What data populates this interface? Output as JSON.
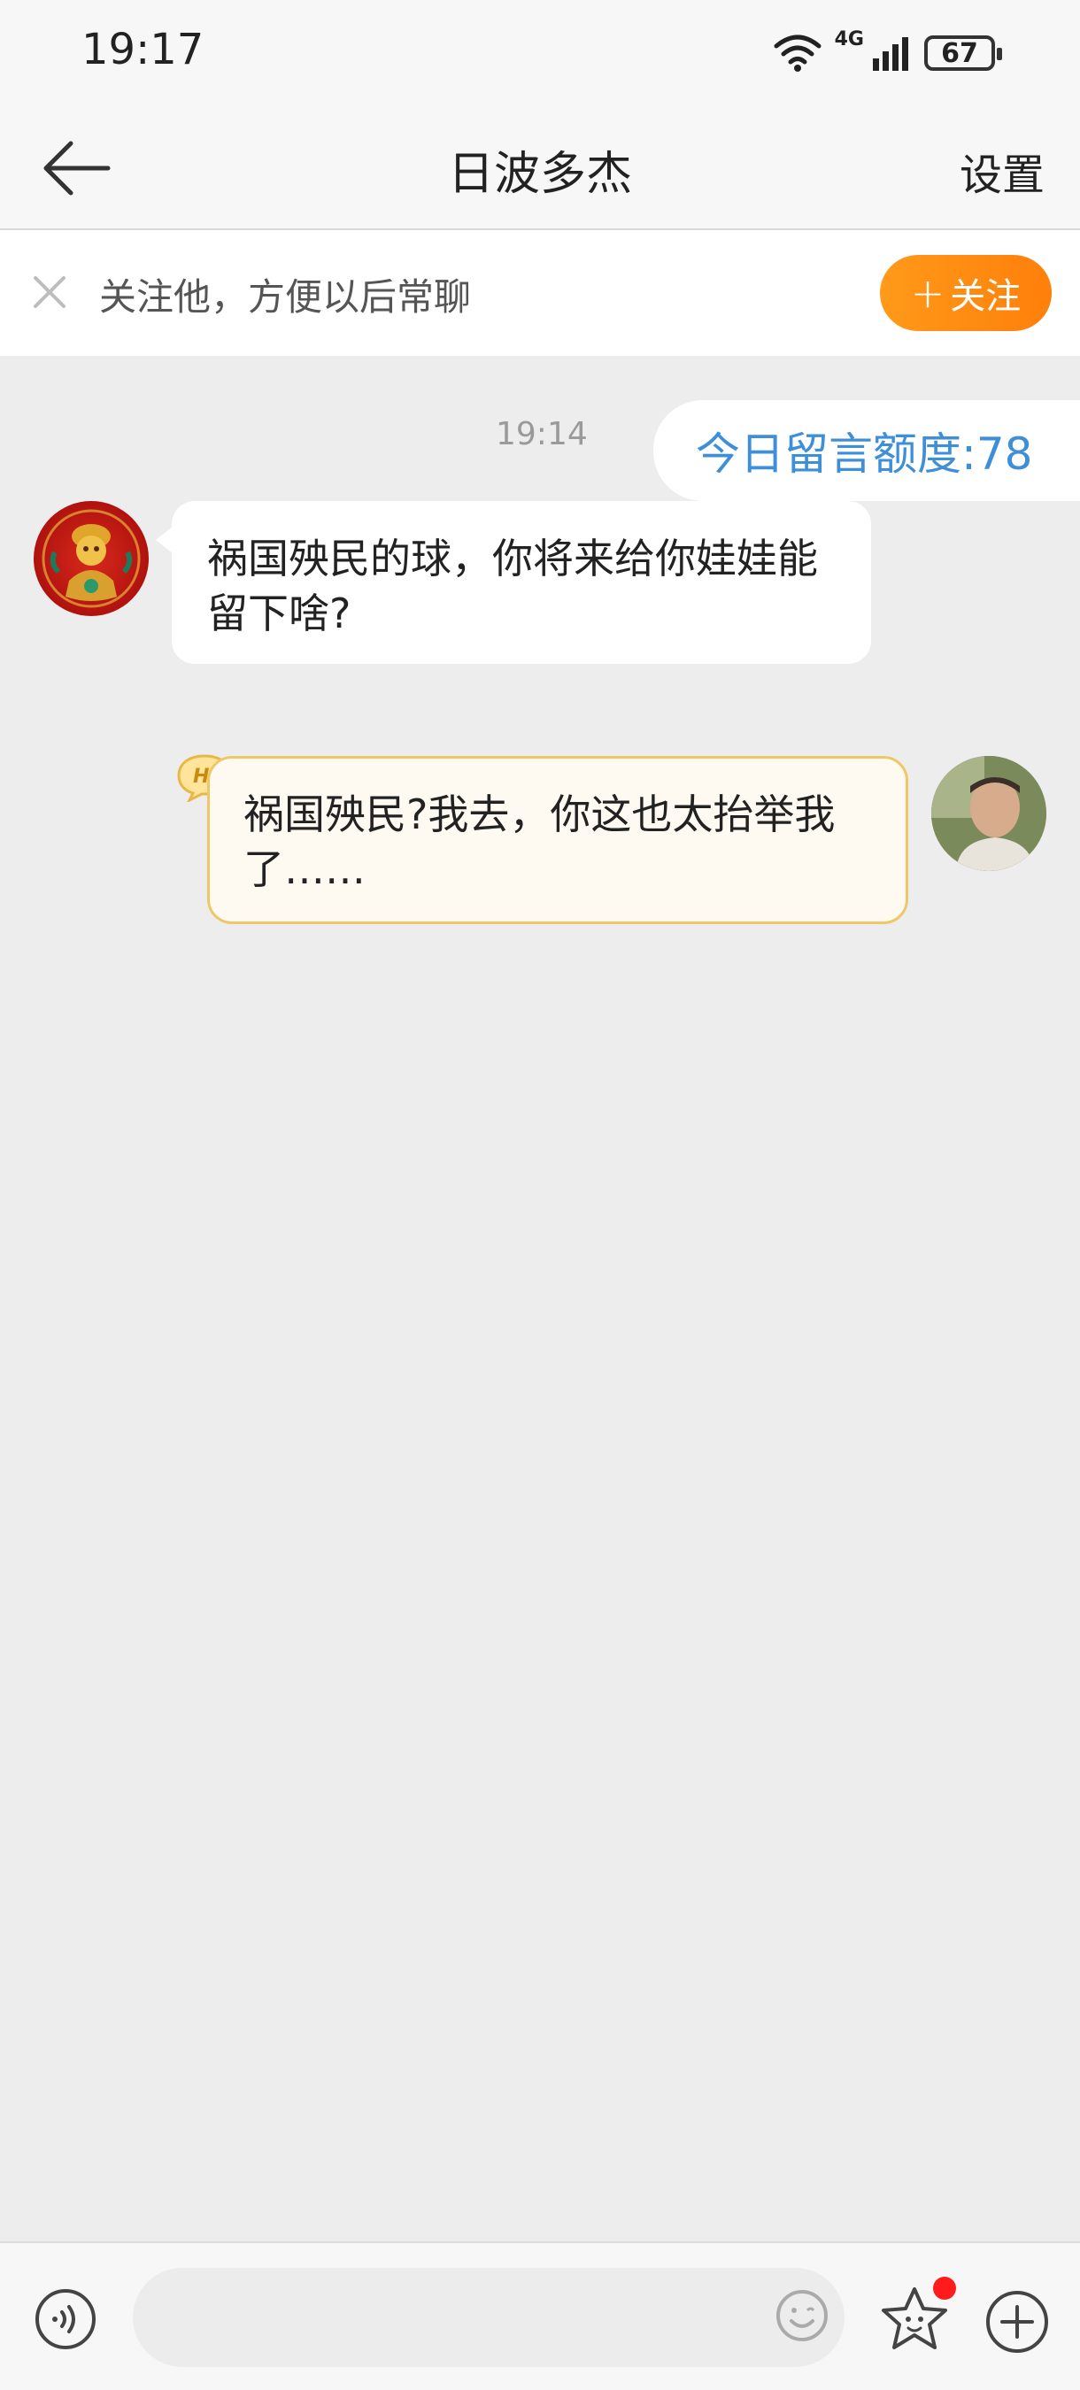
{
  "status_bar": {
    "time": "19:17",
    "network": "4G",
    "battery": "67"
  },
  "nav": {
    "title": "日波多杰",
    "settings_label": "设置"
  },
  "follow_bar": {
    "prompt": "关注他，方便以后常聊",
    "follow_label": "关注"
  },
  "chat": {
    "timestamp": "19:14",
    "quota_notice": "今日留言额度:78",
    "messages": [
      {
        "side": "left",
        "text": "祸国殃民的球，你将来给你娃娃能留下啥?"
      },
      {
        "side": "right",
        "badge": "Hi",
        "text": "祸国殃民?我去，你这也太抬举我了……"
      }
    ]
  },
  "input_bar": {
    "placeholder": ""
  },
  "colors": {
    "accent_orange": "#ff8c14",
    "link_blue": "#3e8fd8",
    "bubble_border": "#f0c766",
    "badge_red": "#ff1b1b"
  },
  "icons": [
    "back-arrow-icon",
    "close-icon",
    "plus-icon",
    "voice-icon",
    "emoji-icon",
    "sticker-icon",
    "add-icon",
    "wifi-icon",
    "signal-icon",
    "battery-icon"
  ]
}
